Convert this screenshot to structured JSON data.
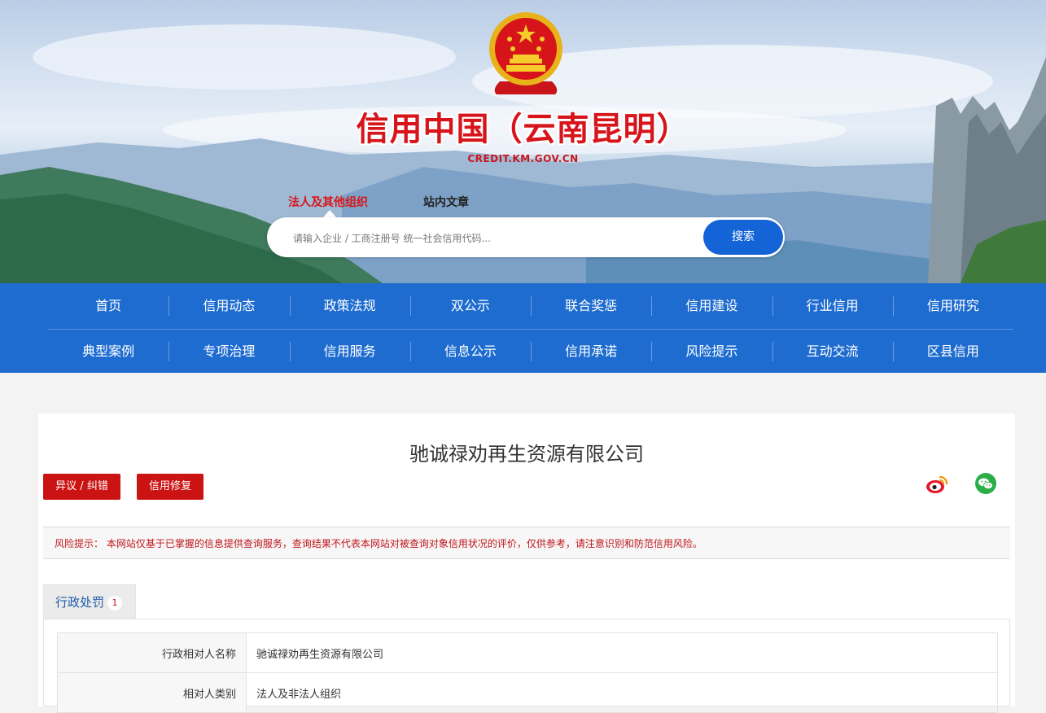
{
  "header": {
    "title": "信用中国（云南昆明）",
    "url_text": "CREDIT.KM.GOV.CN"
  },
  "search": {
    "tabs": [
      "法人及其他组织",
      "站内文章"
    ],
    "active_tab": 0,
    "placeholder": "请输入企业 / 工商注册号 统一社会信用代码...",
    "value": "",
    "button_label": "搜索"
  },
  "nav": {
    "row1": [
      "首页",
      "信用动态",
      "政策法规",
      "双公示",
      "联合奖惩",
      "信用建设",
      "行业信用",
      "信用研究"
    ],
    "row2": [
      "典型案例",
      "专项治理",
      "信用服务",
      "信息公示",
      "信用承诺",
      "风险提示",
      "互动交流",
      "区县信用"
    ]
  },
  "detail": {
    "company_name": "驰诚禄劝再生资源有限公司",
    "objection_button": "异议 / 纠错",
    "repair_button": "信用修复",
    "share_icons": [
      "weibo-icon",
      "wechat-icon"
    ],
    "risk_notice": "风险提示： 本网站仅基于已掌握的信息提供查询服务，查询结果不代表本网站对被查询对象信用状况的评价，仅供参考，请注意识别和防范信用风险。",
    "tab": {
      "label": "行政处罚",
      "count": "1"
    },
    "rows": [
      {
        "label": "行政相对人名称",
        "value": "驰诚禄劝再生资源有限公司"
      },
      {
        "label": "相对人类别",
        "value": "法人及非法人组织"
      }
    ]
  },
  "colors": {
    "nav_blue": "#1e6cd0",
    "brand_red": "#d7141a",
    "button_red": "#cc1313",
    "search_blue": "#1464d8"
  }
}
